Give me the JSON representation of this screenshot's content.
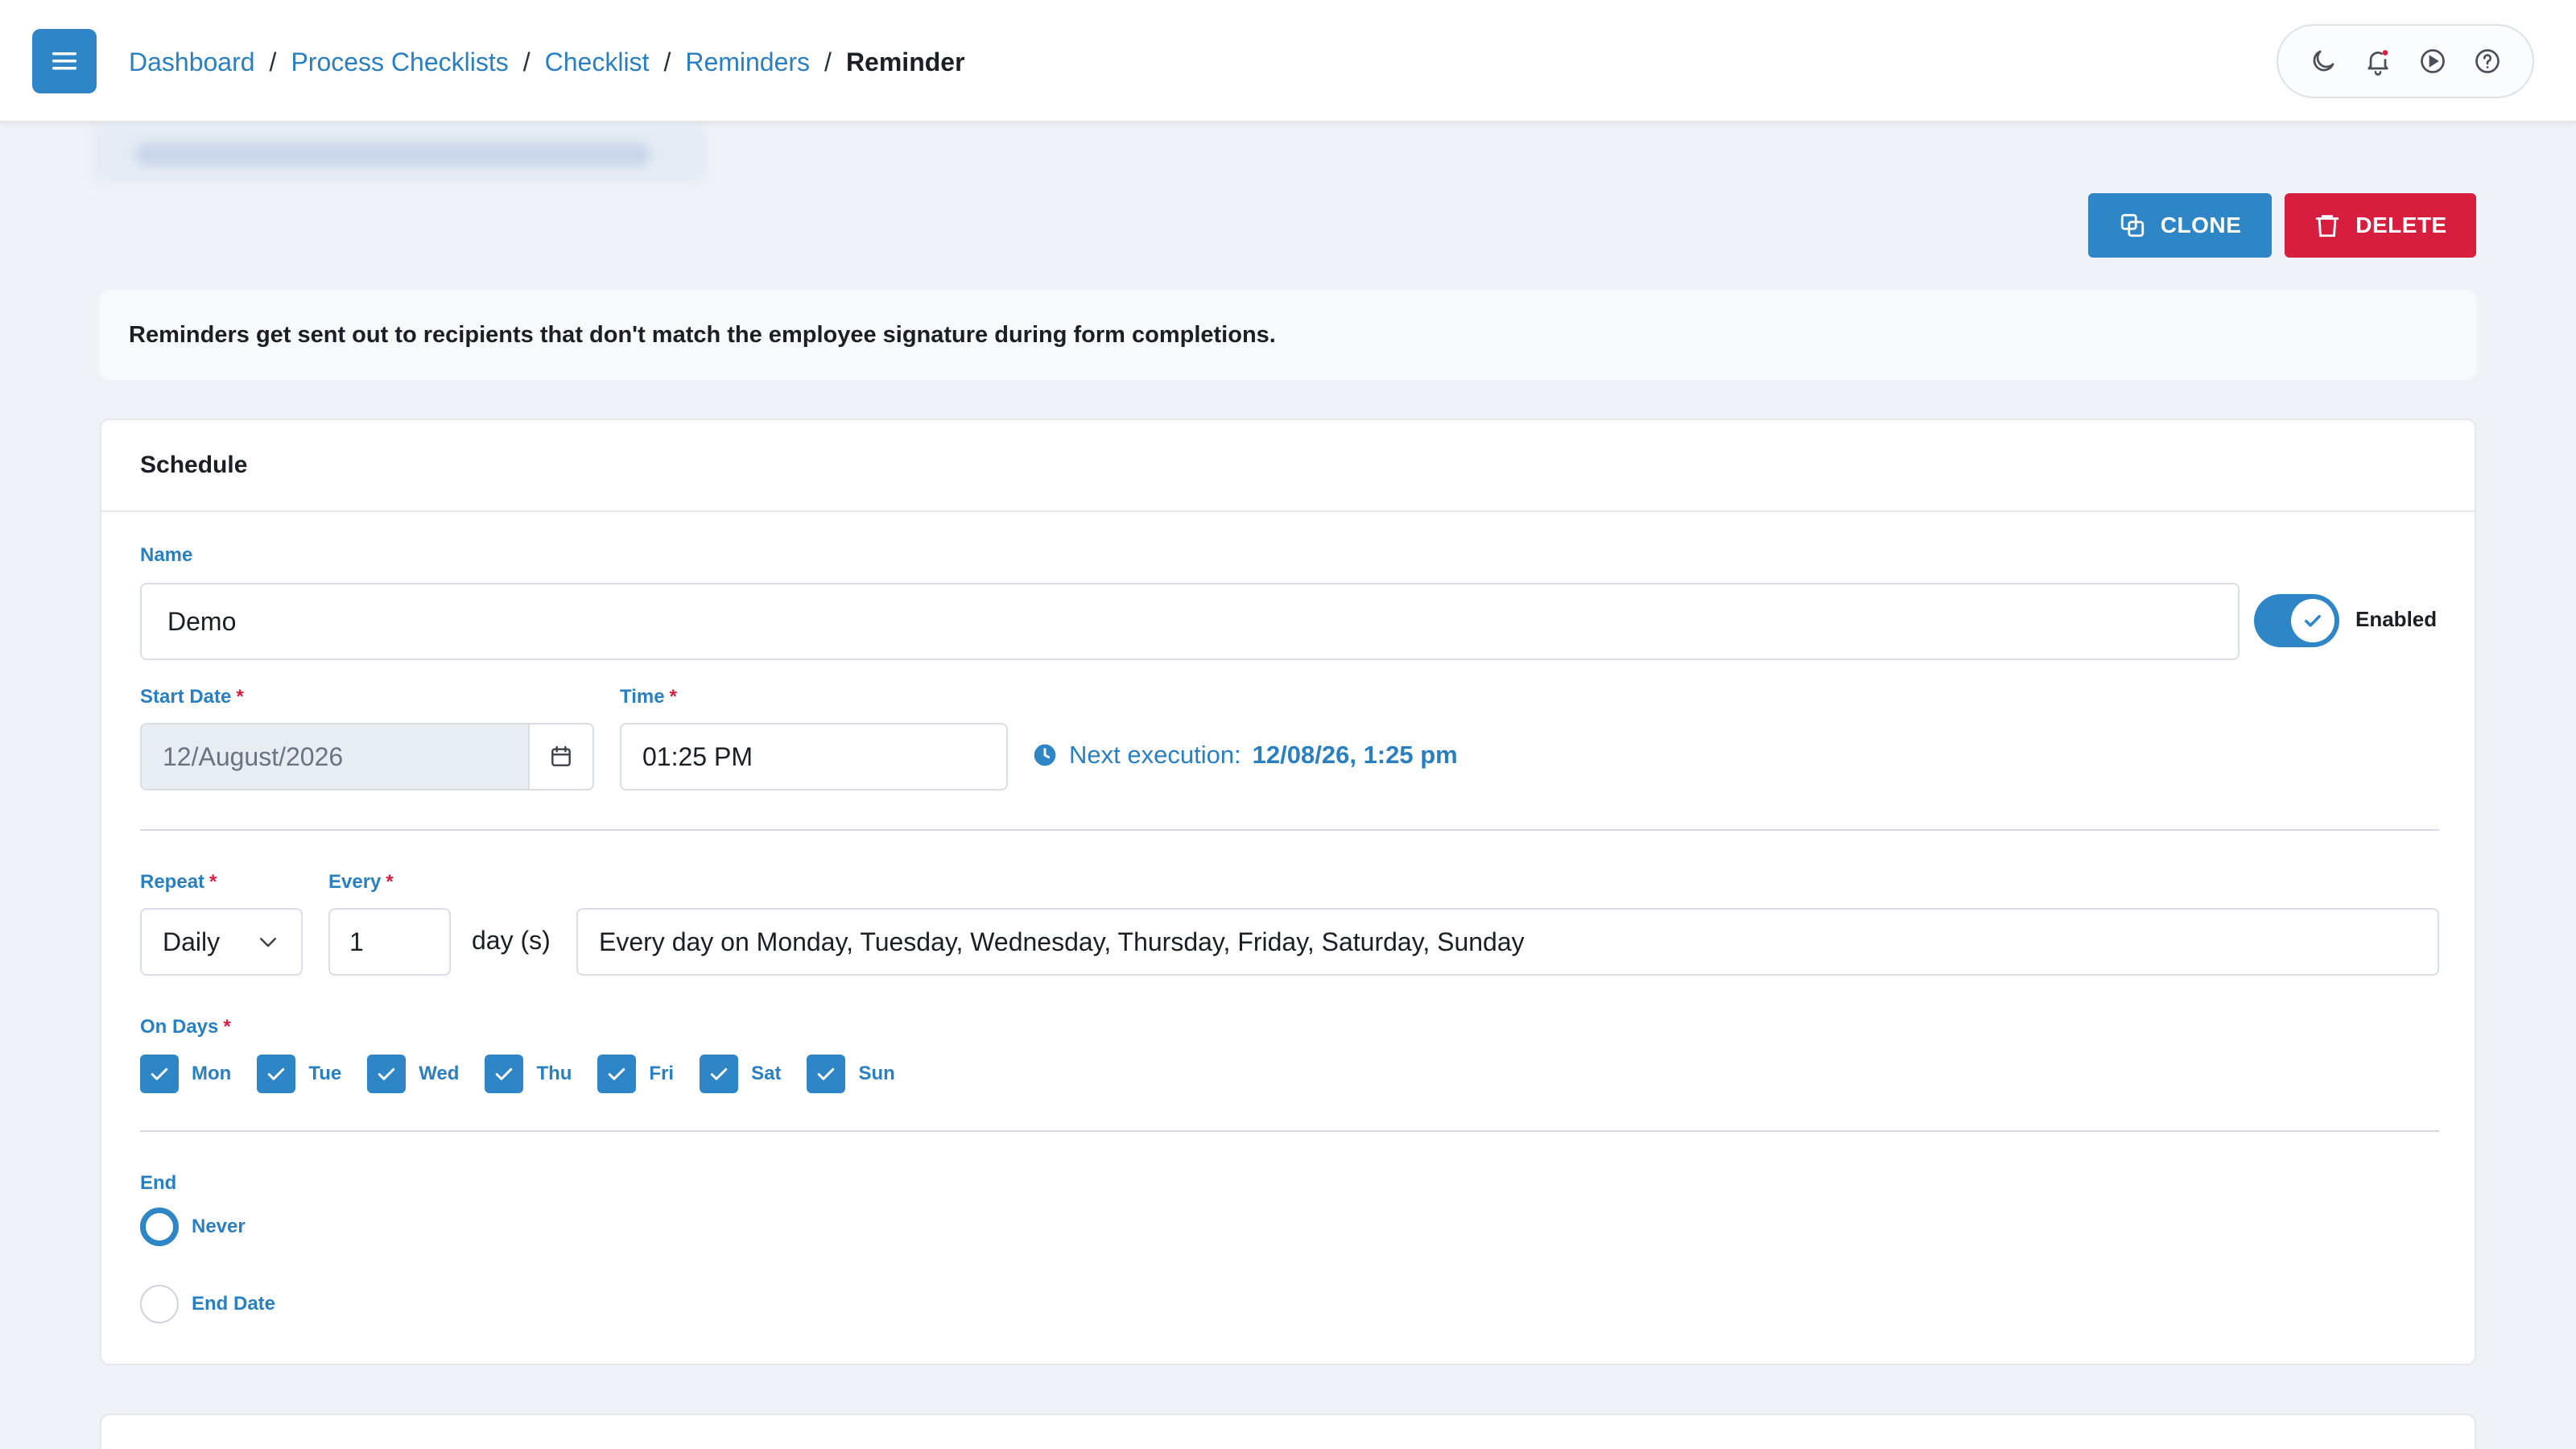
{
  "header": {
    "breadcrumbs": [
      "Dashboard",
      "Process Checklists",
      "Checklist",
      "Reminders"
    ],
    "current": "Reminder",
    "separator": "/",
    "icons": [
      "moon-icon",
      "bell-icon",
      "play-circle-icon",
      "help-icon"
    ]
  },
  "actions": {
    "clone_label": "CLONE",
    "delete_label": "DELETE"
  },
  "info_text": "Reminders get sent out to recipients that don't match the employee signature during form completions.",
  "schedule": {
    "title": "Schedule",
    "name_label": "Name",
    "name_value": "Demo",
    "enabled_label": "Enabled",
    "enabled": true,
    "start_date_label": "Start Date",
    "start_date_value": "12/August/2026",
    "time_label": "Time",
    "time_value": "01:25 PM",
    "next_execution_label": "Next execution:",
    "next_execution_value": "12/08/26, 1:25 pm",
    "required_marker": "*",
    "repeat_label": "Repeat",
    "repeat_value": "Daily",
    "every_label": "Every",
    "every_value": "1",
    "every_unit": "day (s)",
    "summary": "Every day on Monday, Tuesday, Wednesday, Thursday, Friday, Saturday, Sunday",
    "on_days_label": "On Days",
    "days": [
      "Mon",
      "Tue",
      "Wed",
      "Thu",
      "Fri",
      "Sat",
      "Sun"
    ],
    "end_label": "End",
    "end_options": [
      "Never",
      "End Date"
    ],
    "end_selected": "Never"
  },
  "colors": {
    "primary": "#2f86c6",
    "danger": "#d81e3e",
    "background": "#eff2f7"
  }
}
